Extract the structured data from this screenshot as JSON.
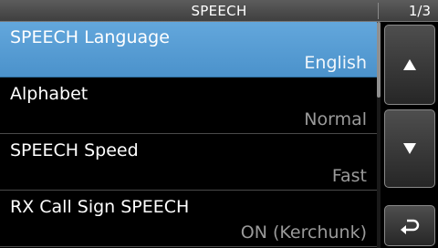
{
  "header": {
    "title": "SPEECH",
    "page_indicator": "1/3"
  },
  "menu": {
    "items": [
      {
        "label": "SPEECH Language",
        "value": "English",
        "selected": true
      },
      {
        "label": "Alphabet",
        "value": "Normal",
        "selected": false
      },
      {
        "label": "SPEECH Speed",
        "value": "Fast",
        "selected": false
      },
      {
        "label": "RX Call Sign SPEECH",
        "value": "ON (Kerchunk)",
        "selected": false
      }
    ]
  },
  "scroll": {
    "page": 1,
    "page_count": 3
  },
  "controls": {
    "up_icon": "triangle-up-icon",
    "down_icon": "triangle-down-icon",
    "back_icon": "return-arrow-icon"
  },
  "colors": {
    "selected_item": "#55a0d8",
    "title_bar": "#4a4a4a",
    "value_text": "#9a9a9a",
    "background": "#000000"
  }
}
